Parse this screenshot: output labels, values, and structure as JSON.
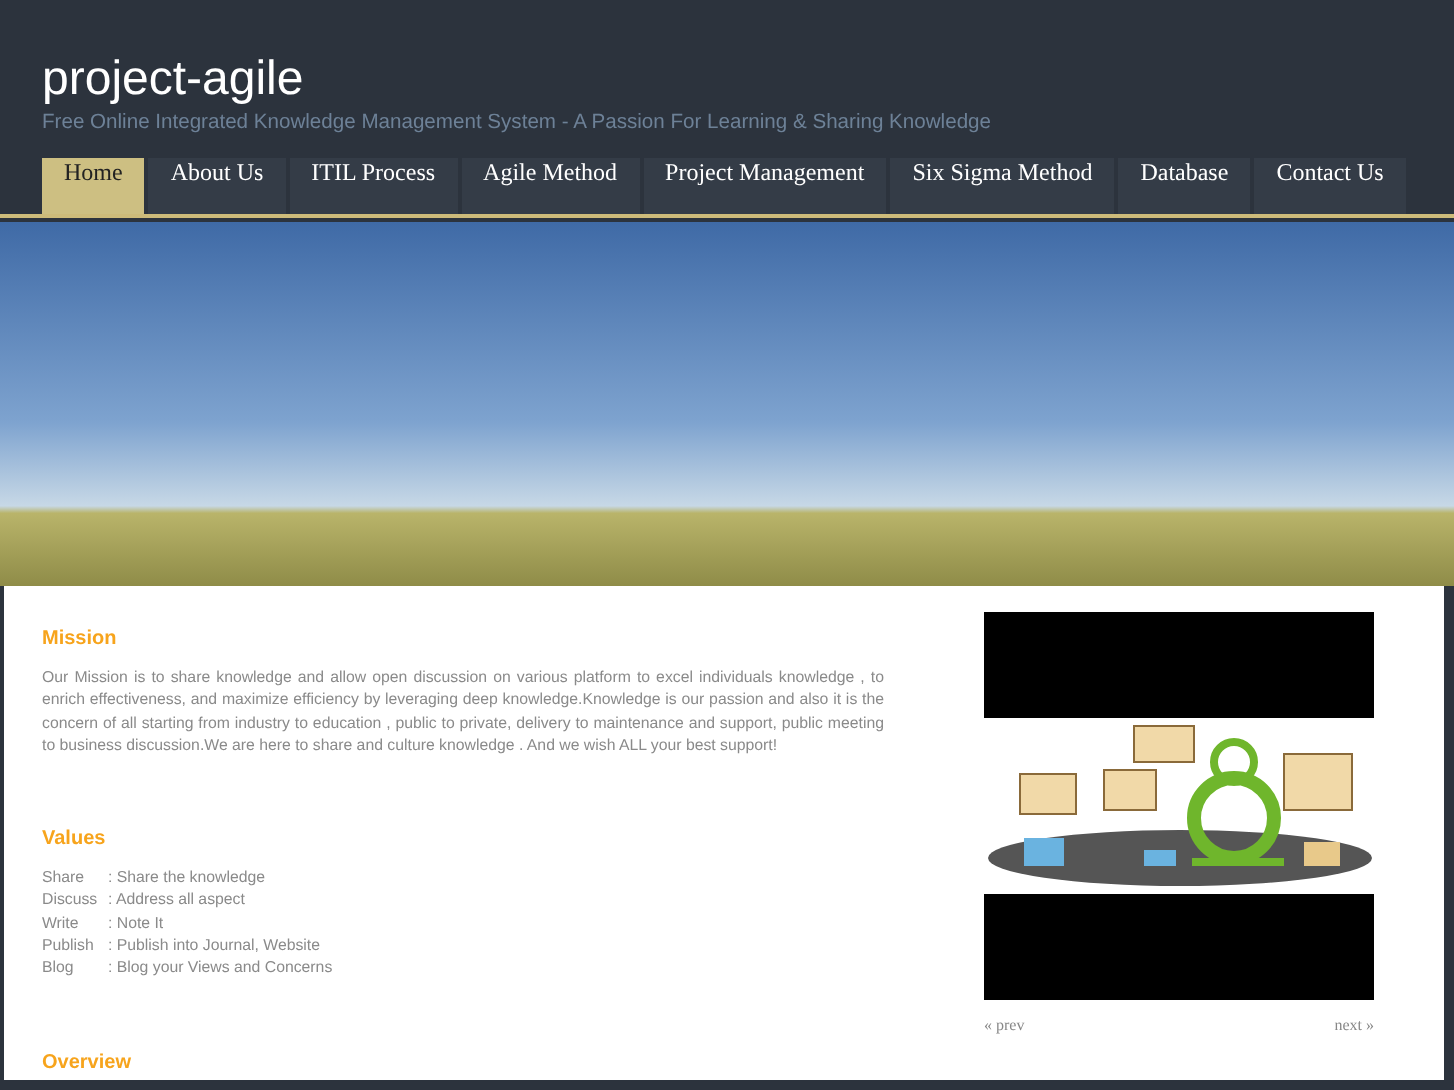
{
  "site": {
    "title": "project-agile",
    "tagline": "Free Online Integrated Knowledge Management System - A Passion For Learning & Sharing Knowledge"
  },
  "nav": [
    {
      "label": "Home",
      "selected": true
    },
    {
      "label": "About Us",
      "selected": false
    },
    {
      "label": "ITIL Process",
      "selected": false
    },
    {
      "label": "Agile Method",
      "selected": false
    },
    {
      "label": "Project Management",
      "selected": false
    },
    {
      "label": "Six Sigma Method",
      "selected": false
    },
    {
      "label": "Database",
      "selected": false
    },
    {
      "label": "Contact Us",
      "selected": false
    }
  ],
  "sections": [
    {
      "heading": "Mission",
      "kind": "paragraph",
      "text": "Our Mission is to share knowledge and allow open discussion on various platform  to excel individuals knowledge , to enrich effectiveness,  and  maximize efficiency by leveraging deep knowledge.Knowledge is our passion and also it is the concern of all starting from industry to education , public to private, delivery to maintenance and support, public meeting to business discussion.We are here to share and culture knowledge . And we  wish ALL your best support!"
    },
    {
      "heading": "Values",
      "kind": "list",
      "items": [
        {
          "term": "Share",
          "desc": ": Share the knowledge"
        },
        {
          "term": "Discuss",
          "desc": ": Address all aspect"
        },
        {
          "term": "Write",
          "desc": ": Note It"
        },
        {
          "term": "Publish",
          "desc": ": Publish into Journal, Website"
        },
        {
          "term": "Blog",
          "desc": ": Blog your Views and Concerns"
        }
      ]
    },
    {
      "heading": "Overview",
      "kind": "paragraph"
    }
  ],
  "slideshow": {
    "prev": "« prev",
    "next": "next »"
  }
}
